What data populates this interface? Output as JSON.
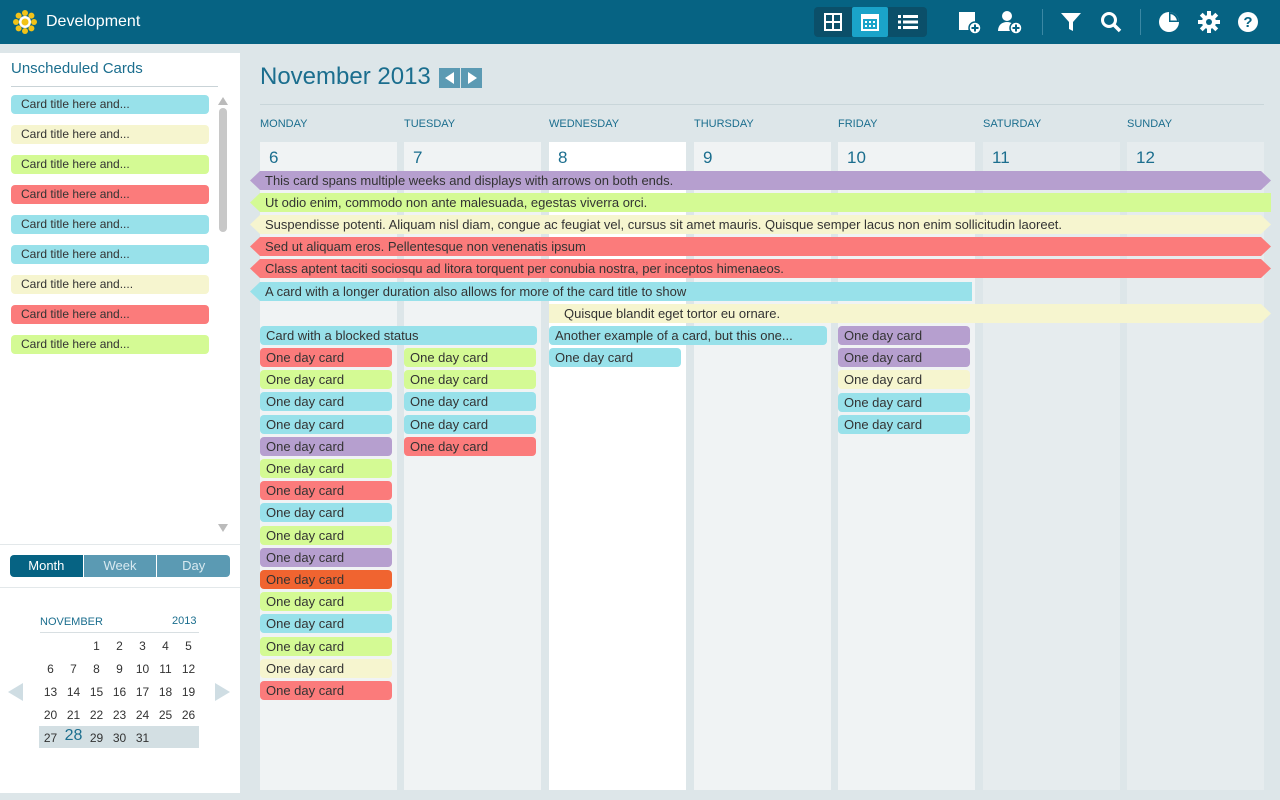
{
  "app": {
    "title": "Development"
  },
  "unscheduled": {
    "title": "Unscheduled Cards",
    "cards": [
      {
        "label": "Card title here and...",
        "color": "#98e1ea"
      },
      {
        "label": "Card title here and...",
        "color": "#f6f5cf"
      },
      {
        "label": "Card title here and...",
        "color": "#d4fa94"
      },
      {
        "label": "Card title here and...",
        "color": "#fb7b7b"
      },
      {
        "label": "Card title here and...",
        "color": "#98e1ea"
      },
      {
        "label": "Card title here and...",
        "color": "#98e1ea"
      },
      {
        "label": "Card title here and....",
        "color": "#f6f5cf"
      },
      {
        "label": "Card title here and...",
        "color": "#fb7b7b"
      },
      {
        "label": "Card title here and...",
        "color": "#d4fa94"
      }
    ]
  },
  "views": {
    "month": "Month",
    "week": "Week",
    "day": "Day",
    "selected": "Month"
  },
  "mini_calendar": {
    "month": "NOVEMBER",
    "year": "2013",
    "selected_day": "28",
    "weeks": [
      [
        "",
        "",
        "",
        "1",
        "2",
        "3",
        "4",
        "5"
      ],
      [
        "6",
        "7",
        "8",
        "9",
        "10",
        "11",
        "12"
      ],
      [
        "13",
        "14",
        "15",
        "16",
        "17",
        "18",
        "19"
      ],
      [
        "20",
        "21",
        "22",
        "23",
        "24",
        "25",
        "26"
      ],
      [
        "27",
        "28",
        "29",
        "30",
        "31"
      ]
    ]
  },
  "calendar": {
    "title": "November 2013",
    "days": [
      {
        "name": "MONDAY",
        "num": "6"
      },
      {
        "name": "TUESDAY",
        "num": "7"
      },
      {
        "name": "WEDNESDAY",
        "num": "8"
      },
      {
        "name": "THURSDAY",
        "num": "9"
      },
      {
        "name": "FRIDAY",
        "num": "10"
      },
      {
        "name": "SATURDAY",
        "num": "11"
      },
      {
        "name": "SUNDAY",
        "num": "12"
      }
    ],
    "span_cards": [
      {
        "label": "This card spans multiple weeks and displays with arrows on both ends.",
        "color": "#b69fcf"
      },
      {
        "label": "Ut odio enim, commodo non ante malesuada, egestas viverra orci.",
        "color": "#d4fa94"
      },
      {
        "label": "Suspendisse potenti. Aliquam nisl diam, congue ac feugiat vel, cursus sit amet mauris. Quisque semper lacus non enim sollicitudin laoreet.",
        "color": "#f6f5cf"
      },
      {
        "label": "Sed ut aliquam eros. Pellentesque non venenatis ipsum",
        "color": "#fb7b7b"
      },
      {
        "label": "Class aptent taciti sociosqu ad litora torquent per conubia nostra, per inceptos himenaeos.",
        "color": "#fb7b7b"
      },
      {
        "label": "A card with a longer duration also allows for more of the card title to show",
        "color": "#98e1ea"
      },
      {
        "label": "Quisque blandit eget tortor eu ornare.",
        "color": "#f6f5cf"
      },
      {
        "label": "Card with a blocked status",
        "color": "#98e1ea"
      },
      {
        "label": "Another example of a card, but this one...",
        "color": "#98e1ea"
      }
    ],
    "monday_cards": [
      {
        "label": "One day card",
        "color": "#fb7b7b"
      },
      {
        "label": "One day card",
        "color": "#d4fa94"
      },
      {
        "label": "One day card",
        "color": "#98e1ea"
      },
      {
        "label": "One day card",
        "color": "#98e1ea"
      },
      {
        "label": "One day card",
        "color": "#b69fcf"
      },
      {
        "label": "One day card",
        "color": "#d4fa94"
      },
      {
        "label": "One day card",
        "color": "#fb7b7b"
      },
      {
        "label": "One day card",
        "color": "#98e1ea"
      },
      {
        "label": "One day card",
        "color": "#d4fa94"
      },
      {
        "label": "One day card",
        "color": "#b69fcf"
      },
      {
        "label": "One day card",
        "color": "#f06430"
      },
      {
        "label": "One day card",
        "color": "#d4fa94"
      },
      {
        "label": "One day card",
        "color": "#98e1ea"
      },
      {
        "label": "One day card",
        "color": "#d4fa94"
      },
      {
        "label": "One day card",
        "color": "#f6f5cf"
      },
      {
        "label": "One day card",
        "color": "#fb7b7b"
      }
    ],
    "tuesday_cards": [
      {
        "label": "One day card",
        "color": "#d4fa94"
      },
      {
        "label": "One day card",
        "color": "#d4fa94"
      },
      {
        "label": "One day card",
        "color": "#98e1ea"
      },
      {
        "label": "One day card",
        "color": "#98e1ea"
      },
      {
        "label": "One day card",
        "color": "#fb7b7b"
      }
    ],
    "wednesday_cards": [
      {
        "label": "One day card",
        "color": "#98e1ea"
      }
    ],
    "friday_cards": [
      {
        "label": "One day card",
        "color": "#b69fcf"
      },
      {
        "label": "One day card",
        "color": "#b69fcf"
      },
      {
        "label": "One day card",
        "color": "#f6f5cf"
      },
      {
        "label": "One day card",
        "color": "#98e1ea"
      },
      {
        "label": "One day card",
        "color": "#98e1ea"
      }
    ]
  },
  "toolbar_icons": [
    "board-view-icon",
    "calendar-view-icon",
    "list-view-icon",
    "add-card-icon",
    "add-user-icon",
    "filter-icon",
    "search-icon",
    "reports-icon",
    "settings-icon",
    "help-icon"
  ]
}
